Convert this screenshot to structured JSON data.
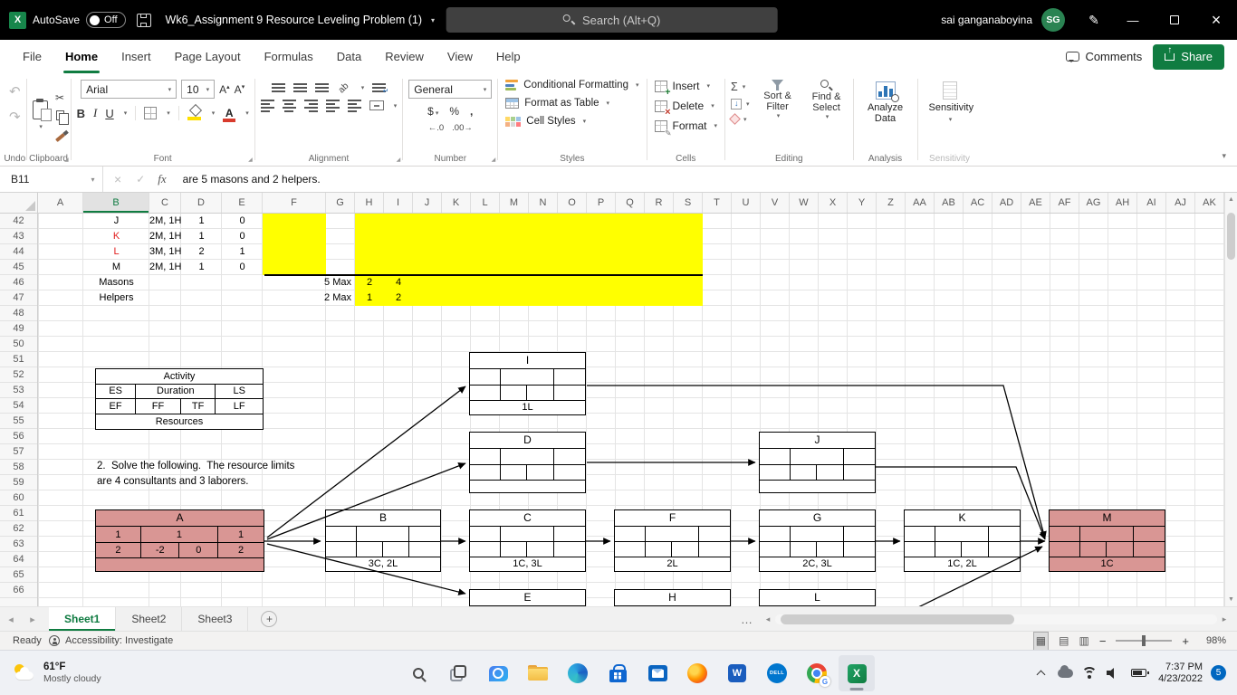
{
  "titlebar": {
    "autosave_label": "AutoSave",
    "autosave_state": "Off",
    "title": "Wk6_Assignment 9 Resource Leveling Problem (1)",
    "search_placeholder": "Search (Alt+Q)",
    "user_name": "sai ganganaboyina",
    "user_initials": "SG"
  },
  "menu": {
    "tabs": [
      {
        "label": "File"
      },
      {
        "label": "Home",
        "active": true
      },
      {
        "label": "Insert"
      },
      {
        "label": "Page Layout"
      },
      {
        "label": "Formulas"
      },
      {
        "label": "Data"
      },
      {
        "label": "Review"
      },
      {
        "label": "View"
      },
      {
        "label": "Help"
      }
    ],
    "comments_label": "Comments",
    "share_label": "Share"
  },
  "ribbon": {
    "font_name": "Arial",
    "font_size": "10",
    "number_format": "General",
    "bold_label": "B",
    "italic_label": "I",
    "underline_label": "U",
    "currency_label": "$",
    "percent_label": "%",
    "comma_label": ",",
    "groups": {
      "undo": "Undo",
      "clipboard": "Clipboard",
      "font": "Font",
      "alignment": "Alignment",
      "number": "Number",
      "styles": "Styles",
      "cells": "Cells",
      "editing": "Editing",
      "analysis": "Analysis",
      "sensitivity": "Sensitivity"
    },
    "styles_items": [
      "Conditional Formatting",
      "Format as Table",
      "Cell Styles"
    ],
    "cells_items": [
      "Insert",
      "Delete",
      "Format"
    ],
    "editing_items": [
      "Sort & Filter",
      "Find & Select"
    ],
    "analysis_button": "Analyze Data",
    "sensitivity_button": "Sensitivity"
  },
  "formula_bar": {
    "name_box": "B11",
    "content": "are 5 masons and 2 helpers."
  },
  "grid": {
    "columns": [
      "A",
      "B",
      "C",
      "D",
      "E",
      "F",
      "G",
      "H",
      "I",
      "J",
      "K",
      "L",
      "M",
      "N",
      "O",
      "P",
      "Q",
      "R",
      "S",
      "T",
      "U",
      "V",
      "W",
      "X",
      "Y",
      "Z",
      "AA",
      "AB",
      "AC",
      "AD",
      "AE",
      "AF",
      "AG",
      "AH",
      "AI",
      "AJ",
      "AK"
    ],
    "active_column": "B",
    "rows": [
      42,
      43,
      44,
      45,
      46,
      47,
      48,
      49,
      50,
      51,
      52,
      53,
      54,
      55,
      56,
      57,
      58,
      59,
      60,
      61,
      62,
      63,
      64,
      65,
      66
    ],
    "cells": [
      {
        "c": "B",
        "r": 42,
        "t": "J"
      },
      {
        "c": "C",
        "r": 42,
        "t": "2M, 1H"
      },
      {
        "c": "D",
        "r": 42,
        "t": "1"
      },
      {
        "c": "E",
        "r": 42,
        "t": "0"
      },
      {
        "c": "B",
        "r": 43,
        "t": "K",
        "red": true
      },
      {
        "c": "C",
        "r": 43,
        "t": "2M, 1H"
      },
      {
        "c": "D",
        "r": 43,
        "t": "1"
      },
      {
        "c": "E",
        "r": 43,
        "t": "0"
      },
      {
        "c": "B",
        "r": 44,
        "t": "L",
        "red": true
      },
      {
        "c": "C",
        "r": 44,
        "t": "3M, 1H"
      },
      {
        "c": "D",
        "r": 44,
        "t": "2"
      },
      {
        "c": "E",
        "r": 44,
        "t": "1"
      },
      {
        "c": "B",
        "r": 45,
        "t": "M"
      },
      {
        "c": "C",
        "r": 45,
        "t": "2M, 1H"
      },
      {
        "c": "D",
        "r": 45,
        "t": "1"
      },
      {
        "c": "E",
        "r": 45,
        "t": "0"
      },
      {
        "c": "B",
        "r": 46,
        "t": "Masons"
      },
      {
        "c": "F",
        "r": 46,
        "t": "5 Max",
        "span": 2,
        "align": "right"
      },
      {
        "c": "H",
        "r": 46,
        "t": "2"
      },
      {
        "c": "I",
        "r": 46,
        "t": "4"
      },
      {
        "c": "B",
        "r": 47,
        "t": "Helpers"
      },
      {
        "c": "F",
        "r": 47,
        "t": "2 Max",
        "span": 2,
        "align": "right"
      },
      {
        "c": "H",
        "r": 47,
        "t": "1"
      },
      {
        "c": "I",
        "r": 47,
        "t": "2"
      }
    ],
    "note_line1": "2.  Solve the following.  The resource limits",
    "note_line2": "are 4 consultants and 3 laborers.",
    "legend": {
      "title": "Activity",
      "r1": [
        "ES",
        "Duration",
        "LS"
      ],
      "r2": [
        "EF",
        "FF",
        "TF",
        "LF"
      ],
      "footer": "Resources"
    }
  },
  "nodes": [
    {
      "id": "I",
      "header": "I",
      "footer": "1L"
    },
    {
      "id": "D",
      "header": "D",
      "footer": ""
    },
    {
      "id": "J",
      "header": "J",
      "footer": ""
    },
    {
      "id": "A",
      "header": "A",
      "footer": "",
      "pink": true,
      "row1": [
        "1",
        "1",
        "1"
      ],
      "row2": [
        "2",
        "-2",
        "0",
        "2"
      ]
    },
    {
      "id": "B",
      "header": "B",
      "footer": "3C, 2L"
    },
    {
      "id": "C",
      "header": "C",
      "footer": "1C, 3L"
    },
    {
      "id": "F",
      "header": "F",
      "footer": "2L"
    },
    {
      "id": "G",
      "header": "G",
      "footer": "2C, 3L"
    },
    {
      "id": "K",
      "header": "K",
      "footer": "1C, 2L"
    },
    {
      "id": "M",
      "header": "M",
      "footer": "1C",
      "pink": true
    },
    {
      "id": "E",
      "header": "E",
      "footer": ""
    },
    {
      "id": "H",
      "header": "H",
      "footer": ""
    },
    {
      "id": "L",
      "header": "L",
      "footer": ""
    }
  ],
  "sheet_tabs": {
    "tabs": [
      "Sheet1",
      "Sheet2",
      "Sheet3"
    ],
    "active": "Sheet1"
  },
  "status_bar": {
    "ready": "Ready",
    "accessibility": "Accessibility: Investigate",
    "zoom_level": "98%"
  },
  "taskbar": {
    "weather_temp": "61°F",
    "weather_desc": "Mostly cloudy",
    "time": "7:37 PM",
    "date": "4/23/2022",
    "notification_count": "5",
    "icons": [
      "start",
      "search",
      "task-view",
      "chat",
      "file-explorer",
      "edge",
      "store",
      "outlook",
      "firefox",
      "word",
      "dell",
      "chrome",
      "excel"
    ],
    "active_icon": "excel"
  }
}
